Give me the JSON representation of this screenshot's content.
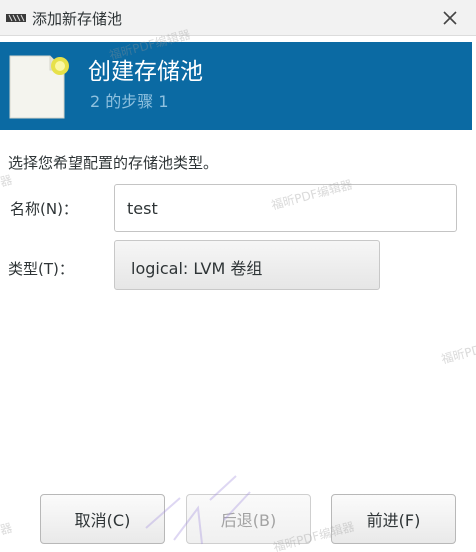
{
  "window": {
    "title": "添加新存储池",
    "close_icon": "close-icon"
  },
  "banner": {
    "title": "创建存储池",
    "step": "2 的步骤 1",
    "background": "#0b6aa3",
    "icon": "new-document-icon"
  },
  "form": {
    "instruction": "选择您希望配置的存储池类型。",
    "name_label": "名称(N)：",
    "name_value": "test",
    "type_label": "类型(T)：",
    "type_value": "logical: LVM 卷组"
  },
  "buttons": {
    "cancel": "取消(C)",
    "back": "后退(B)",
    "forward": "前进(F)"
  },
  "watermark": {
    "text": "福昕PDF编辑器",
    "text_short": "福昕PDF编辑器",
    "text_fragment": "器"
  }
}
